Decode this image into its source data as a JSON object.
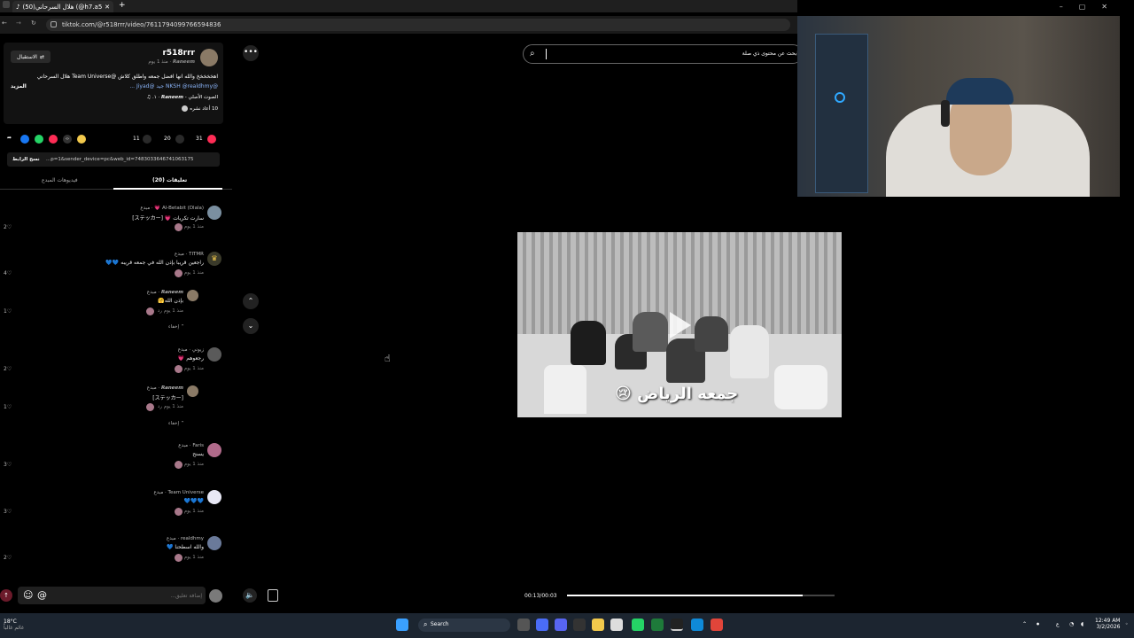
{
  "browser": {
    "tab_title": "(50)هلال السرحاني (@h7.a5) | tiktok",
    "url": "tiktok.com/@r518rrr/video/7611794099766594836"
  },
  "author": {
    "follow_label": "الاستقبال",
    "username": "r518rrr",
    "display": "𝙍𝙖𝙣𝙚𝙚𝙢 · منذ 1 يوم"
  },
  "caption": {
    "line1": "اهخخخخخ والله انها افضل جمعه واطلق كلاش @Team Universe هلال السرحاني",
    "line2": "@NKSH @realdhmy جيد @Jiyad ...",
    "more": "المزيد",
    "music": "الصوت الأصلي - 𝙍𝙖𝙣𝙚𝙚𝙢 · ١.",
    "reposts": "10 أعاد نشره"
  },
  "stats": {
    "likes": "31",
    "comments": "20",
    "saves": "11"
  },
  "link": {
    "value": "...p=1&sender_device=pc&web_id=7483033646741063175",
    "copy_label": "نسخ الرابط"
  },
  "tabs": {
    "comments": "تعليقات (20)",
    "creator_videos": "فيديوهات المبدع"
  },
  "comments": [
    {
      "name": "Al-Betabit (Dlala) 💗 · مبدع",
      "text": "سارت تكريات 💗 [ステッカー]",
      "meta": "منذ 1 يوم  رد",
      "likes": "2"
    },
    {
      "name": "TITMR · مبدع",
      "text": "راجعين قريبا بإذن الله في جمعه قريبه 💙💙",
      "meta": "منذ 1 يوم  رد",
      "likes": "4"
    },
    {
      "name": "𝙍𝙖𝙣𝙚𝙚𝙢 · مبدع",
      "text": "بإذن الله🤗",
      "meta": "منذ 1 يوم  رد",
      "likes": "1"
    },
    {
      "name": "زيوني · مبدع",
      "text": "رجعوهم 💗",
      "meta": "منذ 1 يوم  رد",
      "likes": "2"
    },
    {
      "name": "𝙍𝙖𝙣𝙚𝙚𝙢 · مبدع",
      "text": "[ステッカー]",
      "meta": "منذ 1 يوم  رد",
      "likes": "1"
    },
    {
      "name": "Faris · مبدع",
      "text": "يسنح",
      "meta": "منذ 1 يوم  رد",
      "likes": "3"
    },
    {
      "name": "Team Universe · مبدع",
      "text": "💙💙💙",
      "meta": "منذ 1 يوم  رد",
      "likes": "3"
    },
    {
      "name": "realdhmy · مبدع",
      "text": "والله اسطحنا 💙",
      "meta": "منذ 1 يوم  رد",
      "likes": "2"
    }
  ],
  "hide_label": "إخفاء",
  "composer": {
    "placeholder": "إضافة تعليق..."
  },
  "video": {
    "search_placeholder": "ابحث عن محتوى ذي صلة",
    "overlay_text": "جمعه الرياض 😢",
    "time": "00:13/00:03",
    "progress": 0.88
  },
  "taskbar": {
    "weather_temp": "18°C",
    "weather_desc": "غائم غالباً",
    "search_label": "Search",
    "lang": "ع",
    "time": "12:49 AM",
    "date": "3/2/2026"
  },
  "icons": [
    "search-icon",
    "more-icon",
    "chevron-up-icon",
    "chevron-down-icon",
    "volume-icon",
    "pip-icon",
    "heart-icon",
    "comment-icon",
    "bookmark-icon",
    "share-icon",
    "emoji-icon",
    "mention-icon",
    "windows-start-icon",
    "wifi-icon"
  ],
  "colors": {
    "accent": "#fe2c55",
    "link": "#8ab4f8",
    "taskbar": "#1c2530"
  }
}
